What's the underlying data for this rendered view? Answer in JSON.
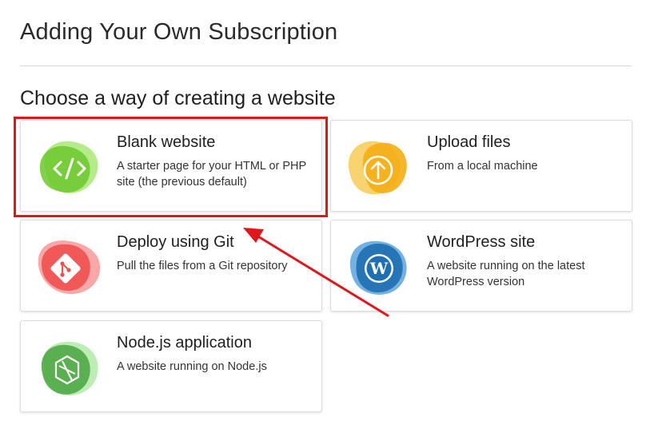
{
  "page": {
    "title": "Adding Your Own Subscription",
    "section_title": "Choose a way of creating a website"
  },
  "cards": [
    {
      "title": "Blank website",
      "description": "A starter page for your HTML or PHP site (the previous default)",
      "icon": "code-icon",
      "color": "#7ed43a"
    },
    {
      "title": "Upload files",
      "description": "From a local machine",
      "icon": "upload-icon",
      "color": "#f6b623"
    },
    {
      "title": "Deploy using Git",
      "description": "Pull the files from a Git repository",
      "icon": "git-icon",
      "color": "#f04f4f"
    },
    {
      "title": "WordPress site",
      "description": "A website running on the latest WordPress version",
      "icon": "wordpress-icon",
      "color": "#1e73be"
    },
    {
      "title": "Node.js application",
      "description": "A website running on Node.js",
      "icon": "nodejs-icon",
      "color": "#5bb552"
    }
  ],
  "annotation": {
    "highlight_color": "#e0161c"
  }
}
